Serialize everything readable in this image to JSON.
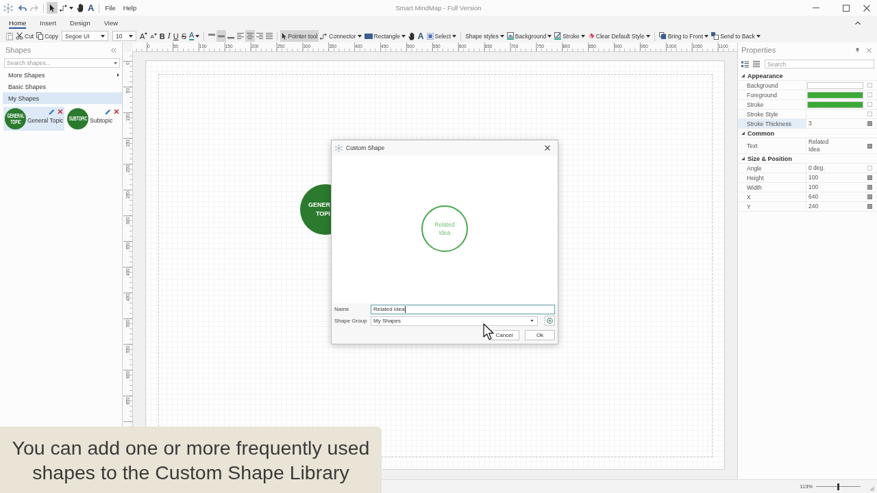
{
  "title_bar": {
    "undo": {
      "disabled": false
    },
    "redo": {
      "disabled": true
    },
    "tools": [
      {
        "selected": true
      },
      {
        "selected": false
      },
      {
        "selected": false
      },
      {
        "label": "A",
        "selected": false
      }
    ],
    "menus": [
      {
        "label": "File"
      },
      {
        "label": "Help"
      }
    ],
    "title": "Smart MindMap - Full Version"
  },
  "ribbon_tabs": [
    {
      "label": "Home",
      "selected": true
    },
    {
      "label": "Insert",
      "selected": false
    },
    {
      "label": "Design",
      "selected": false
    },
    {
      "label": "View",
      "selected": false
    }
  ],
  "toolbar": {
    "paste": {
      "disabled": true
    },
    "cut": {
      "label": "Cut"
    },
    "copy": {
      "label": "Copy"
    },
    "font_family": {
      "value": "Segoe UI"
    },
    "font_size": {
      "value": "10"
    },
    "grow_font": {
      "label": "A"
    },
    "shrink_font": {
      "label": "A"
    },
    "bold": {
      "label": "B"
    },
    "italic": {
      "label": "I"
    },
    "underline": {
      "label": "U"
    },
    "strikethrough": {
      "label": "S"
    },
    "font_color": {
      "label": "A"
    },
    "vertical_align": [
      {
        "selected": false
      },
      {
        "selected": true
      },
      {
        "selected": false
      }
    ],
    "horizontal_align": [
      {
        "selected": false
      },
      {
        "selected": true
      },
      {
        "selected": false
      },
      {
        "selected": false
      }
    ],
    "tools": [
      {
        "label": "Pointer tool",
        "selected": true
      },
      {
        "label": "Connector",
        "selected": false
      },
      {
        "label": "Rectangle",
        "selected": false
      },
      {
        "selected": false
      },
      {
        "label": "A",
        "selected": false
      }
    ],
    "select": {
      "label": "Select"
    },
    "shape_styles": {
      "label": "Shape styles"
    },
    "background": {
      "label": "Background"
    },
    "stroke": {
      "label": "Stroke"
    },
    "clear_default_style": {
      "label": "Clear Default Style"
    },
    "bring_to_front": {
      "label": "Bring to Front"
    },
    "send_to_back": {
      "label": "Send to Back"
    }
  },
  "shapes_panel": {
    "title": "Shapes",
    "search": {
      "placeholder": "Search shapes..."
    },
    "groups": [
      {
        "label": "More Shapes",
        "submenu": true,
        "selected": false
      },
      {
        "label": "Basic Shapes",
        "submenu": false,
        "selected": false
      },
      {
        "label": "My Shapes",
        "submenu": false,
        "selected": true
      }
    ],
    "shapes": [
      {
        "thumbnail_text": "GENERAL TOPIC",
        "label": "General Topic",
        "selected": true
      },
      {
        "thumbnail_text": "SUBTOPIC",
        "label": "Subtopic",
        "selected": false
      }
    ]
  },
  "rulers": {
    "horizontal": [
      "0",
      "50",
      "100",
      "150",
      "200",
      "250",
      "300",
      "350",
      "400",
      "450",
      "500",
      "550",
      "600",
      "650",
      "700",
      "750",
      "800",
      "850",
      "900",
      "950",
      "1000",
      "1050",
      "1100"
    ],
    "vertical": [
      "0",
      "50",
      "100",
      "150",
      "200",
      "250",
      "300",
      "350",
      "400",
      "450",
      "500",
      "550",
      "600",
      "650"
    ]
  },
  "canvas": {
    "topic": {
      "lines": [
        "GENER",
        "TOPI"
      ]
    }
  },
  "dialog": {
    "title": "Custom Shape",
    "preview_text": "Related Idea",
    "name": {
      "label": "Name",
      "value": "Related Idea"
    },
    "shape_group": {
      "label": "Shape Group",
      "value": "My Shapes"
    },
    "buttons": [
      {
        "label": "Cancel"
      },
      {
        "label": "Ok"
      }
    ]
  },
  "properties_panel": {
    "title": "Properties",
    "search": {
      "placeholder": "Search"
    },
    "groups": [
      {
        "name": "Appearance",
        "expanded": true,
        "rows": [
          {
            "name": "Background",
            "kind": "swatch",
            "color": "#ffffff",
            "value_set": false,
            "selected": false
          },
          {
            "name": "Foreground",
            "kind": "swatch",
            "color": "#3aaa35",
            "value_set": false,
            "selected": false
          },
          {
            "name": "Stroke",
            "kind": "swatch",
            "color": "#3aaa35",
            "value_set": false,
            "selected": false
          },
          {
            "name": "Stroke Style",
            "kind": "text",
            "value_set": false,
            "selected": false
          },
          {
            "name": "Stroke Thickness",
            "kind": "text",
            "value": "3",
            "value_set": true,
            "selected": true
          }
        ]
      },
      {
        "name": "Common",
        "expanded": true,
        "rows": [
          {
            "name": "Text",
            "kind": "text",
            "value": "Related\nIdea",
            "value_set": true,
            "selected": false
          }
        ]
      },
      {
        "name": "Size & Position",
        "expanded": true,
        "rows": [
          {
            "name": "Angle",
            "kind": "text",
            "value": "0 deg.",
            "value_set": false,
            "selected": false
          },
          {
            "name": "Height",
            "kind": "text",
            "value": "100",
            "value_set": true,
            "selected": false
          },
          {
            "name": "Width",
            "kind": "text",
            "value": "100",
            "value_set": true,
            "selected": false
          },
          {
            "name": "X",
            "kind": "text",
            "value": "640",
            "value_set": true,
            "selected": false
          },
          {
            "name": "Y",
            "kind": "text",
            "value": "240",
            "value_set": true,
            "selected": false
          }
        ]
      }
    ]
  },
  "status_bar": {
    "zoom": "113%",
    "zoom_slider": {
      "level": 0.5
    }
  },
  "caption": "You can add one or more frequently used\nshapes to the Custom Shape Library"
}
